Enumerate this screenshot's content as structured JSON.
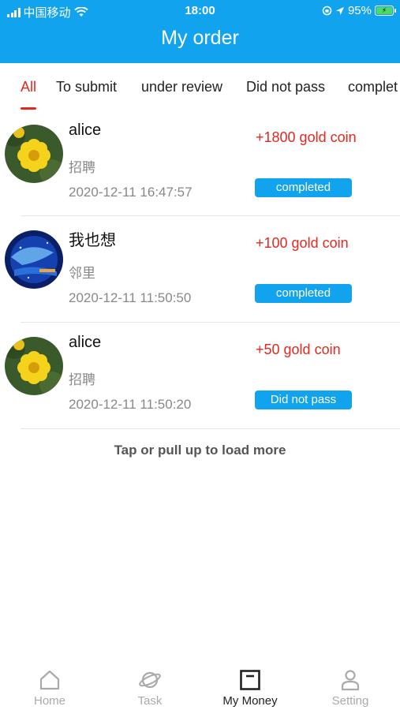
{
  "status_bar": {
    "carrier": "中国移动",
    "time": "18:00",
    "battery": "95%"
  },
  "header": {
    "title": "My order"
  },
  "tabs": [
    {
      "label": "All",
      "active": true
    },
    {
      "label": "To submit",
      "active": false
    },
    {
      "label": "under review",
      "active": false
    },
    {
      "label": "Did not pass",
      "active": false
    },
    {
      "label": "complet",
      "active": false
    }
  ],
  "orders": [
    {
      "name": "alice",
      "subtitle": "招聘",
      "time": "2020-12-11 16:47:57",
      "reward": "+1800 gold coin",
      "status": "completed",
      "avatar": "yellow-flower"
    },
    {
      "name": "我也想",
      "subtitle": "邻里",
      "time": "2020-12-11 11:50:50",
      "reward": "+100 gold coin",
      "status": "completed",
      "avatar": "blue-whale"
    },
    {
      "name": "alice",
      "subtitle": "招聘",
      "time": "2020-12-11 11:50:20",
      "reward": "+50 gold coin",
      "status": "Did not pass",
      "avatar": "yellow-flower"
    }
  ],
  "load_more": "Tap or pull up to load more",
  "tabbar": [
    {
      "label": "Home",
      "icon": "home-icon",
      "active": false
    },
    {
      "label": "Task",
      "icon": "planet-icon",
      "active": false
    },
    {
      "label": "My Money",
      "icon": "wallet-icon",
      "active": true
    },
    {
      "label": "Setting",
      "icon": "user-icon",
      "active": false
    }
  ],
  "colors": {
    "primary": "#12a3ee",
    "accent_red": "#e5281f"
  }
}
